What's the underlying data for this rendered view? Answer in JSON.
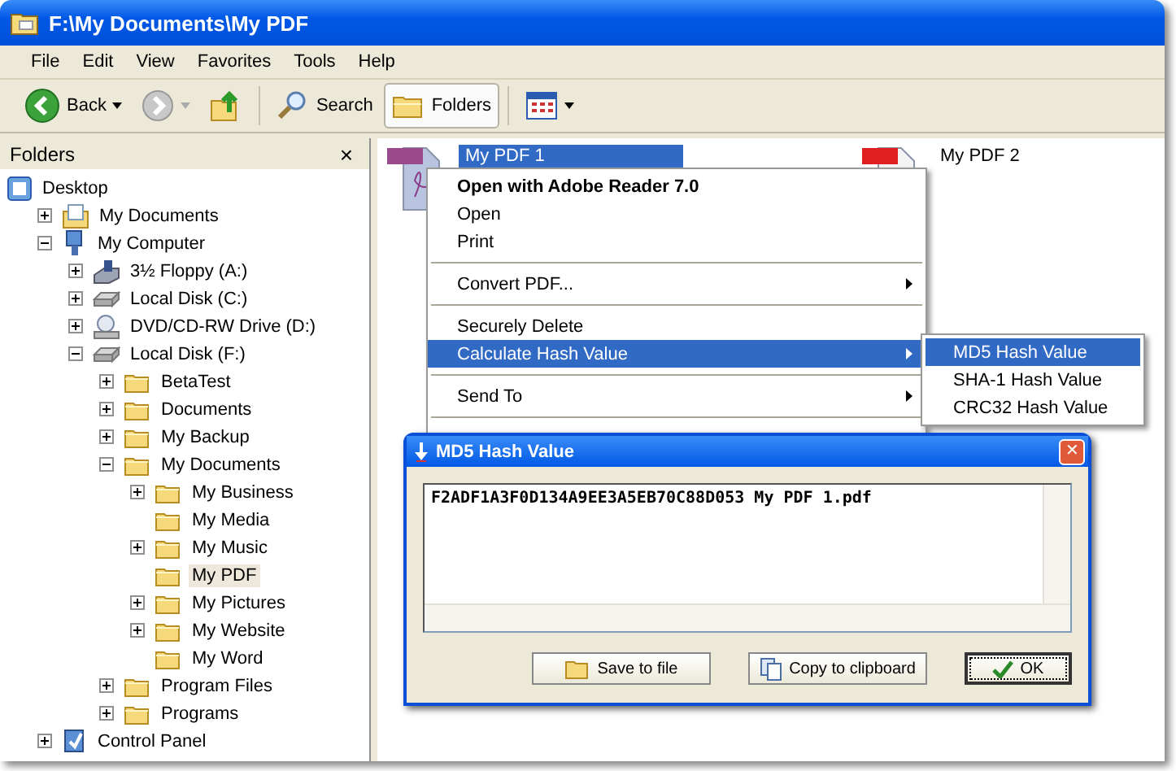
{
  "window": {
    "title": "F:\\My Documents\\My PDF"
  },
  "menu": [
    "File",
    "Edit",
    "View",
    "Favorites",
    "Tools",
    "Help"
  ],
  "toolbar": [
    {
      "kind": "back",
      "label": "Back"
    },
    {
      "kind": "forward"
    },
    {
      "kind": "up"
    },
    {
      "kind": "search",
      "label": "Search",
      "selected": false
    },
    {
      "kind": "folders",
      "label": "Folders",
      "selected": true
    },
    {
      "kind": "views"
    }
  ],
  "folders_pane": {
    "title": "Folders",
    "close": "×"
  },
  "tree": [
    {
      "label": "Desktop",
      "kind": "desktop",
      "selected": false,
      "children": [
        {
          "label": "My Documents",
          "kind": "mydocs",
          "expanded": false,
          "selected": false
        },
        {
          "label": "My Computer",
          "kind": "computer",
          "expanded": true,
          "selected": false,
          "children": [
            {
              "label": "3½ Floppy (A:)",
              "kind": "floppy",
              "expanded": false,
              "selected": false
            },
            {
              "label": "Local Disk (C:)",
              "kind": "disk",
              "expanded": false,
              "selected": false
            },
            {
              "label": "DVD/CD-RW Drive (D:)",
              "kind": "cdrom",
              "expanded": false,
              "selected": false
            },
            {
              "label": "Local Disk (F:)",
              "kind": "disk",
              "expanded": true,
              "selected": false,
              "children": [
                {
                  "label": "BetaTest",
                  "kind": "folder",
                  "expanded": false,
                  "selected": false
                },
                {
                  "label": "Documents",
                  "kind": "folder",
                  "expanded": false,
                  "selected": false
                },
                {
                  "label": "My Backup",
                  "kind": "folder",
                  "expanded": false,
                  "selected": false
                },
                {
                  "label": "My Documents",
                  "kind": "folder",
                  "expanded": true,
                  "selected": false,
                  "children": [
                    {
                      "label": "My Business",
                      "kind": "folder",
                      "expanded": false,
                      "selected": false
                    },
                    {
                      "label": "My Media",
                      "kind": "folder",
                      "selected": false
                    },
                    {
                      "label": "My Music",
                      "kind": "folder",
                      "expanded": false,
                      "selected": false
                    },
                    {
                      "label": "My PDF",
                      "kind": "folder",
                      "selected": true
                    },
                    {
                      "label": "My Pictures",
                      "kind": "folder",
                      "expanded": false,
                      "selected": false
                    },
                    {
                      "label": "My Website",
                      "kind": "folder",
                      "expanded": false,
                      "selected": false
                    },
                    {
                      "label": "My Word",
                      "kind": "folder",
                      "selected": false
                    }
                  ]
                },
                {
                  "label": "Program Files",
                  "kind": "folder",
                  "expanded": false,
                  "selected": false
                },
                {
                  "label": "Programs",
                  "kind": "folder",
                  "expanded": false,
                  "selected": false
                }
              ]
            }
          ]
        },
        {
          "label": "Control Panel",
          "kind": "control",
          "expanded": false,
          "selected": false
        }
      ]
    }
  ],
  "files": [
    {
      "name": "My PDF 1",
      "selected": true
    },
    {
      "name": "My PDF 2",
      "selected": false
    }
  ],
  "context_menu": [
    {
      "kind": "item",
      "label": "Open with Adobe Reader 7.0",
      "bold": true,
      "submenu": false,
      "selected": false
    },
    {
      "kind": "item",
      "label": "Open",
      "bold": false,
      "submenu": false,
      "selected": false
    },
    {
      "kind": "item",
      "label": "Print",
      "bold": false,
      "submenu": false,
      "selected": false
    },
    {
      "kind": "separator"
    },
    {
      "kind": "item",
      "label": "Convert PDF...",
      "bold": false,
      "submenu": true,
      "selected": false
    },
    {
      "kind": "separator"
    },
    {
      "kind": "item",
      "label": "Securely Delete",
      "bold": false,
      "submenu": false,
      "selected": false
    },
    {
      "kind": "item",
      "label": "Calculate Hash Value",
      "bold": false,
      "submenu": true,
      "selected": true
    },
    {
      "kind": "separator"
    },
    {
      "kind": "item",
      "label": "Send To",
      "bold": false,
      "submenu": true,
      "selected": false
    },
    {
      "kind": "separator"
    }
  ],
  "submenu": [
    {
      "label": "MD5 Hash Value",
      "selected": true
    },
    {
      "label": "SHA-1 Hash Value",
      "selected": false
    },
    {
      "label": "CRC32 Hash Value",
      "selected": false
    }
  ],
  "dialog": {
    "title": "MD5 Hash Value",
    "close": "✕",
    "content": "F2ADF1A3F0D134A9EE3A5EB70C88D053 My PDF 1.pdf",
    "buttons": [
      {
        "kind": "save",
        "label": "Save to file",
        "default": false
      },
      {
        "kind": "copy",
        "label": "Copy to clipboard",
        "default": false
      },
      {
        "kind": "ok",
        "label": "OK",
        "default": true
      }
    ]
  }
}
